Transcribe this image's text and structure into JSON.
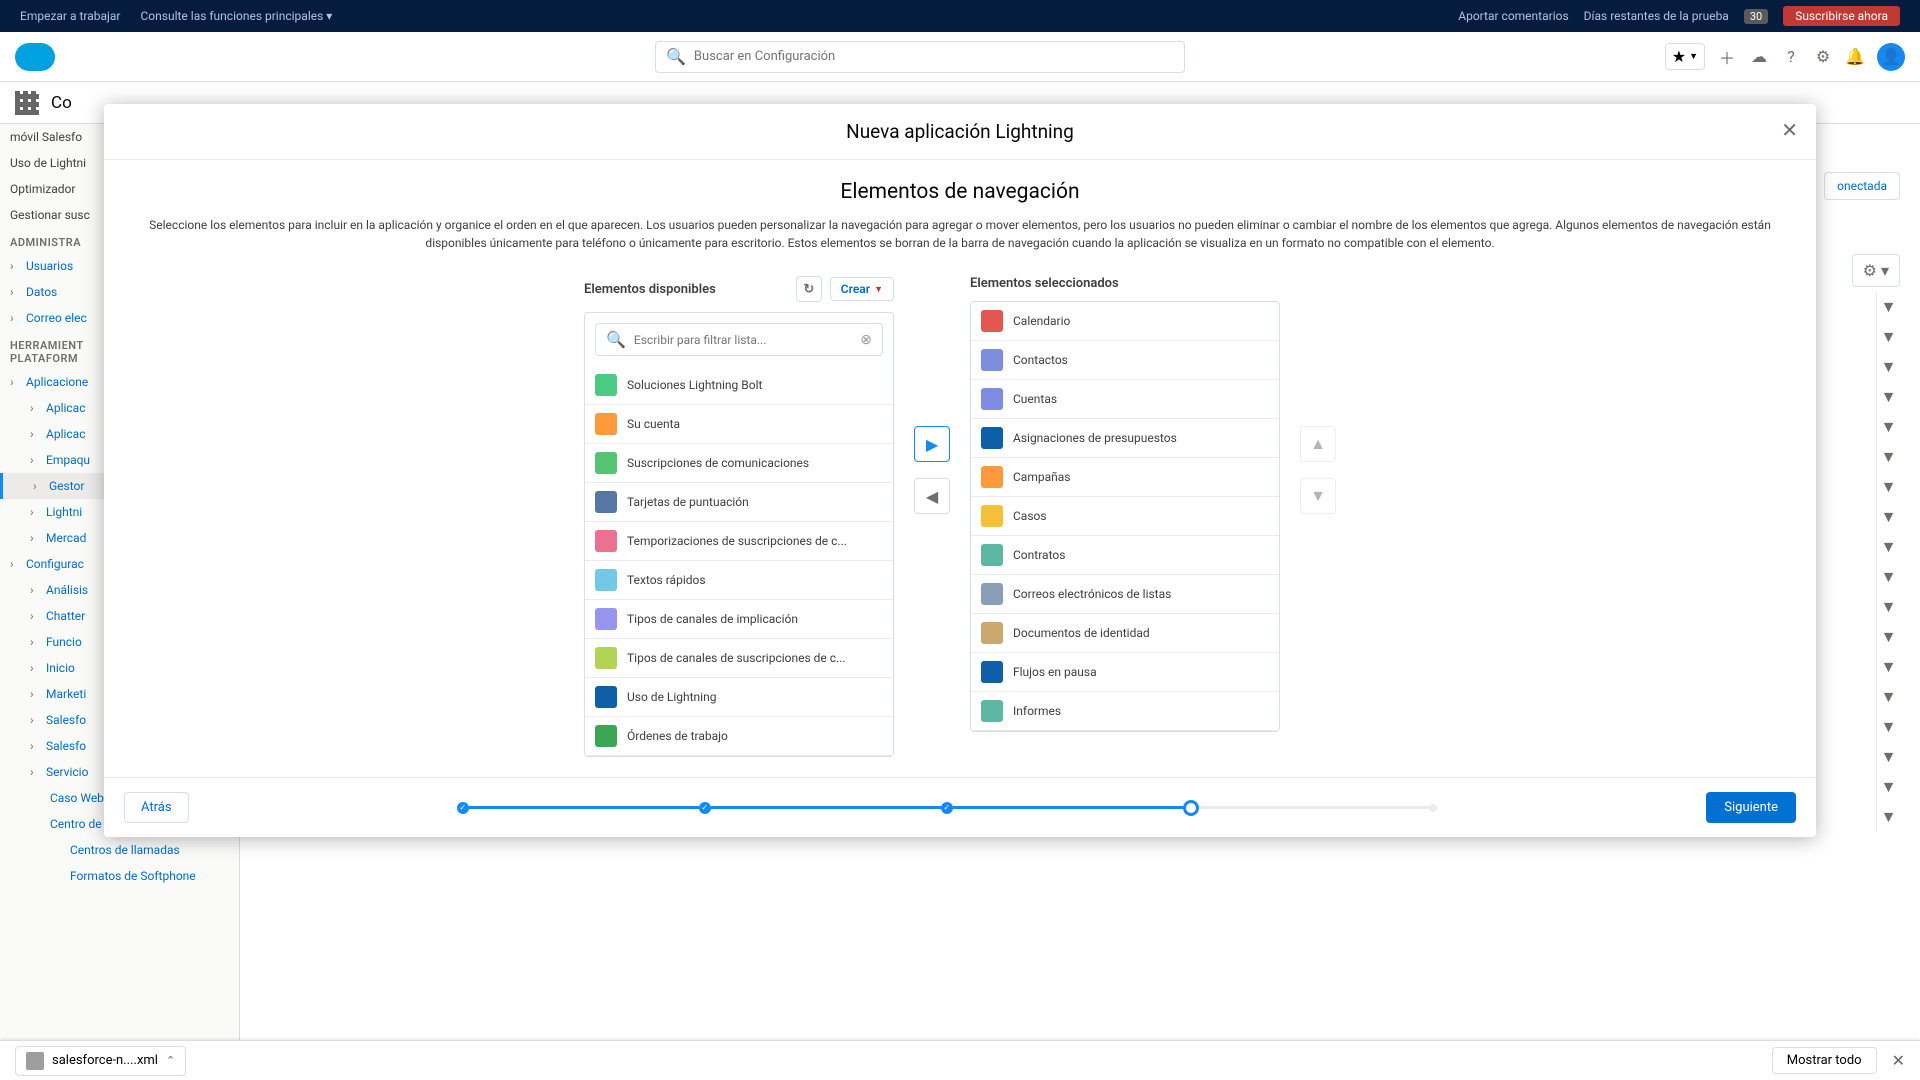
{
  "topbar": {
    "getStarted": "Empezar a trabajar",
    "consultFunctions": "Consulte las funciones principales",
    "feedback": "Aportar comentarios",
    "trialDays": "Días restantes de la prueba",
    "trialCount": "30",
    "subscribe": "Suscribirse ahora"
  },
  "header": {
    "searchPlaceholder": "Buscar en Configuración"
  },
  "subheader": {
    "appName": "Co"
  },
  "sidebar": {
    "items1": [
      "móvil Salesfo",
      "Uso de Lightni",
      "Optimizador",
      "Gestionar susc"
    ],
    "section1": "ADMINISTRA",
    "items2": [
      "Usuarios",
      "Datos",
      "Correo elec"
    ],
    "section2": "HERRAMIENT\nPLATAFORM",
    "items3": [
      "Aplicacione",
      "Aplicac",
      "Aplicac",
      "Empaqu",
      "Gestor",
      "Lightni",
      "Mercad"
    ],
    "items4": [
      "Configurac",
      "Análisis",
      "Chatter",
      "Funcio",
      "Inicio",
      "Marketi",
      "Salesfo",
      "Salesfo",
      "Servicio",
      "Caso Web",
      "Centro de llamadas",
      "Centros de llamadas",
      "Formatos de Softphone"
    ]
  },
  "main": {
    "connected": "onectada"
  },
  "modal": {
    "title": "Nueva aplicación Lightning",
    "subtitle": "Elementos de navegación",
    "description": "Seleccione los elementos para incluir en la aplicación y organice el orden en el que aparecen. Los usuarios pueden personalizar la navegación para agregar o mover elementos, pero los usuarios no pueden eliminar o cambiar el nombre de los elementos que agrega. Algunos elementos de navegación están disponibles únicamente para teléfono o únicamente para escritorio. Estos elementos se borran de la barra de navegación cuando la aplicación se visualiza en un formato no compatible con el elemento.",
    "availableHeader": "Elementos disponibles",
    "selectedHeader": "Elementos seleccionados",
    "createBtn": "Crear",
    "filterPlaceholder": "Escribir para filtrar lista...",
    "available": [
      {
        "label": "Soluciones Lightning Bolt",
        "color": "ic-green"
      },
      {
        "label": "Su cuenta",
        "color": "ic-orange"
      },
      {
        "label": "Suscripciones de comunicaciones",
        "color": "ic-teal"
      },
      {
        "label": "Tarjetas de puntuación",
        "color": "ic-darkblue"
      },
      {
        "label": "Temporizaciones de suscripciones de c...",
        "color": "ic-pink"
      },
      {
        "label": "Textos rápidos",
        "color": "ic-cyan"
      },
      {
        "label": "Tipos de canales de implicación",
        "color": "ic-purple"
      },
      {
        "label": "Tipos de canales de suscripciones de c...",
        "color": "ic-lime"
      },
      {
        "label": "Uso de Lightning",
        "color": "ic-navy"
      },
      {
        "label": "Órdenes de trabajo",
        "color": "ic-tealr"
      }
    ],
    "selected": [
      {
        "label": "Calendario",
        "color": "ic-red"
      },
      {
        "label": "Contactos",
        "color": "ic-indigo"
      },
      {
        "label": "Cuentas",
        "color": "ic-indigo"
      },
      {
        "label": "Asignaciones de presupuestos",
        "color": "ic-navy"
      },
      {
        "label": "Campañas",
        "color": "ic-orange"
      },
      {
        "label": "Casos",
        "color": "ic-yellow"
      },
      {
        "label": "Contratos",
        "color": "ic-mint"
      },
      {
        "label": "Correos electrónicos de listas",
        "color": "ic-gray"
      },
      {
        "label": "Documentos de identidad",
        "color": "ic-tan"
      },
      {
        "label": "Flujos en pausa",
        "color": "ic-navy"
      },
      {
        "label": "Informes",
        "color": "ic-mint"
      }
    ],
    "back": "Atrás",
    "next": "Siguiente"
  },
  "download": {
    "filename": "salesforce-n....xml",
    "showAll": "Mostrar todo"
  }
}
